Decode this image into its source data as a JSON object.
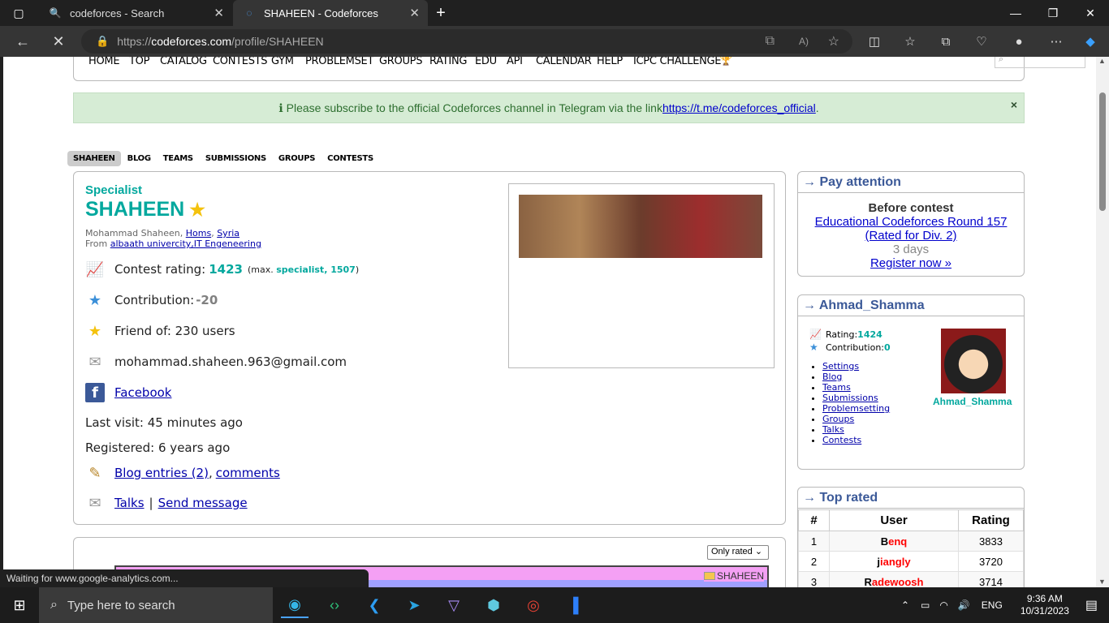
{
  "browser": {
    "tabs": [
      {
        "title": "codeforces - Search",
        "icon": "search-icon"
      },
      {
        "title": "SHAHEEN - Codeforces",
        "icon": "loading-spinner-icon"
      }
    ],
    "url_prefix": "https://",
    "url_domain": "codeforces.com",
    "url_path": "/profile/SHAHEEN",
    "status_text": "Waiting for www.google-analytics.com..."
  },
  "menu": {
    "items": [
      "HOME",
      "TOP",
      "CATALOG",
      "CONTESTS",
      "GYM",
      "PROBLEMSET",
      "GROUPS",
      "RATING",
      "EDU",
      "API",
      "CALENDAR",
      "HELP",
      "ICPC CHALLENGE"
    ]
  },
  "notice": {
    "text": "Please subscribe to the official Codeforces channel in Telegram via the link ",
    "link": "https://t.me/codeforces_official",
    "suffix": ".",
    "close": "×"
  },
  "profile_tabs": [
    "SHAHEEN",
    "BLOG",
    "TEAMS",
    "SUBMISSIONS",
    "GROUPS",
    "CONTESTS"
  ],
  "profile": {
    "rank": "Specialist",
    "handle": "SHAHEEN",
    "name_line": "Mohammad Shaheen, ",
    "city": "Homs",
    "country": "Syria",
    "from_label": "From ",
    "organization": "albaath univercity,IT Engeneering",
    "rating_label": "Contest rating: ",
    "rating": "1423",
    "max_prefix": "(max. ",
    "max_rank": "specialist, 1507",
    "max_suffix": ")",
    "contribution_label": "Contribution: ",
    "contribution": "-20",
    "friend_label": "Friend of: 230 users",
    "email": "mohammad.shaheen.963@gmail.com",
    "facebook": "Facebook",
    "last_visit": "Last visit: 45 minutes ago",
    "registered": "Registered: 6 years ago",
    "blog_entries": "Blog entries (2)",
    "comments": "comments",
    "talks": "Talks",
    "send_message": "Send message"
  },
  "chart": {
    "filter": "Only rated",
    "legend": "SHAHEEN"
  },
  "pay_attention": {
    "title": "→ Pay attention",
    "before": "Before contest",
    "contest": "Educational Codeforces Round 157 (Rated for Div. 2)",
    "time": "3 days",
    "register": "Register now »"
  },
  "user_box": {
    "title": "→ Ahmad_Shamma",
    "rating_label": "Rating: ",
    "rating": "1424",
    "contribution_label": "Contribution: ",
    "contribution": "0",
    "links": [
      "Settings",
      "Blog",
      "Teams",
      "Submissions",
      "Problemsetting",
      "Groups",
      "Talks",
      "Contests"
    ],
    "avatar_name": "Ahmad_Shamma"
  },
  "top_rated": {
    "title": "→ Top rated",
    "headers": [
      "#",
      "User",
      "Rating"
    ],
    "rows": [
      {
        "rank": "1",
        "first": "B",
        "rest": "enq",
        "rating": "3833"
      },
      {
        "rank": "2",
        "first": "j",
        "rest": "iangly",
        "rating": "3720"
      },
      {
        "rank": "3",
        "first": "R",
        "rest": "adewoosh",
        "rating": "3714"
      }
    ]
  },
  "taskbar": {
    "search_placeholder": "Type here to search",
    "language": "ENG",
    "time": "9:36 AM",
    "date": "10/31/2023"
  },
  "colors": {
    "specialist": "#03a89e",
    "link": "#0000cc",
    "notice_bg": "#d6ecd5",
    "title_blue": "#3b5998"
  }
}
